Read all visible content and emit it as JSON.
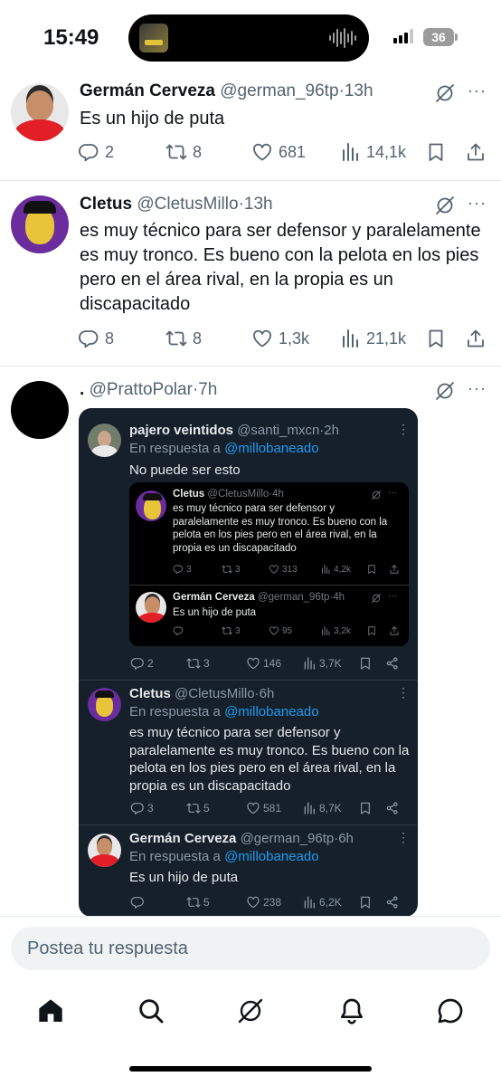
{
  "status_bar": {
    "time": "15:49",
    "battery": "36"
  },
  "tweets": [
    {
      "name": "Germán Cerveza",
      "handle": "@german_96tp",
      "time": "13h",
      "text": "Es un hijo de puta",
      "replies": "2",
      "retweets": "8",
      "likes": "681",
      "views": "14,1k"
    },
    {
      "name": "Cletus",
      "handle": "@CletusMillo",
      "time": "13h",
      "text": "es muy técnico para ser defensor y paralelamente es muy tronco. Es bueno con la pelota en los pies pero en el área rival, en la propia es un discapacitado",
      "replies": "8",
      "retweets": "8",
      "likes": "1,3k",
      "views": "21,1k"
    },
    {
      "name": ".",
      "handle": "@PrattoPolar",
      "time": "7h"
    }
  ],
  "separator": "·",
  "more": "···",
  "embedded": {
    "reply_prefix": "En respuesta a",
    "reply_to": "@millobaneado",
    "posts": [
      {
        "name": "pajero veintidos",
        "handle": "@santi_mxcn",
        "time": "2h",
        "text": "No puede ser esto",
        "replies": "2",
        "retweets": "3",
        "likes": "146",
        "views": "3,7K"
      },
      {
        "name": "Cletus",
        "handle": "@CletusMillo",
        "time": "6h",
        "text": "es muy técnico para ser defensor y paralelamente es muy tronco. Es bueno con la pelota en los pies pero en el área rival, en la propia es un discapacitado",
        "replies": "3",
        "retweets": "5",
        "likes": "581",
        "views": "8,7K"
      },
      {
        "name": "Germán Cerveza",
        "handle": "@german_96tp",
        "time": "6h",
        "text": "Es un hijo de puta",
        "replies": "",
        "retweets": "5",
        "likes": "238",
        "views": "6,2K"
      }
    ],
    "nested": [
      {
        "name": "Cletus",
        "handle": "@CletusMillo",
        "time": "4h",
        "text": "es muy técnico para ser defensor y paralelamente es muy tronco. Es bueno con la pelota en los pies pero en el área rival, en la propia es un discapacitado",
        "replies": "3",
        "retweets": "3",
        "likes": "313",
        "views": "4,2k"
      },
      {
        "name": "Germán Cerveza",
        "handle": "@german_96tp",
        "time": "4h",
        "text": "Es un hijo de puta",
        "replies": "",
        "retweets": "3",
        "likes": "95",
        "views": "3,2k"
      }
    ]
  },
  "reply_input": {
    "placeholder": "Postea tu respuesta"
  },
  "tab_bar": [
    "home-icon",
    "search-icon",
    "grok-icon",
    "notifications-icon",
    "messages-icon"
  ],
  "colors": {
    "link": "#1d9bf0",
    "dark_bg": "#15202b",
    "muted": "#536471"
  }
}
